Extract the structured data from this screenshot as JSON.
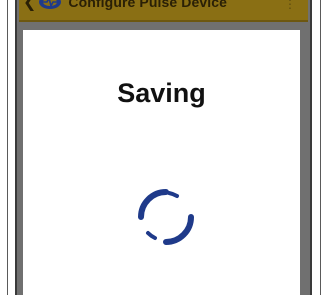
{
  "appbar": {
    "title": "Configure Pulse Device",
    "back_icon": "chevron-left-icon",
    "logo_icon": "pulse-logo-icon",
    "menu_icon": "overflow-menu-icon"
  },
  "dialog": {
    "title": "Saving",
    "spinner_icon": "loading-spinner-icon"
  },
  "colors": {
    "appbar_bg": "#8a6f14",
    "appbar_text": "#2a2006",
    "device_frame": "#707070",
    "dialog_bg": "#ffffff",
    "title_text": "#111111",
    "spinner": "#1f3a8a"
  }
}
